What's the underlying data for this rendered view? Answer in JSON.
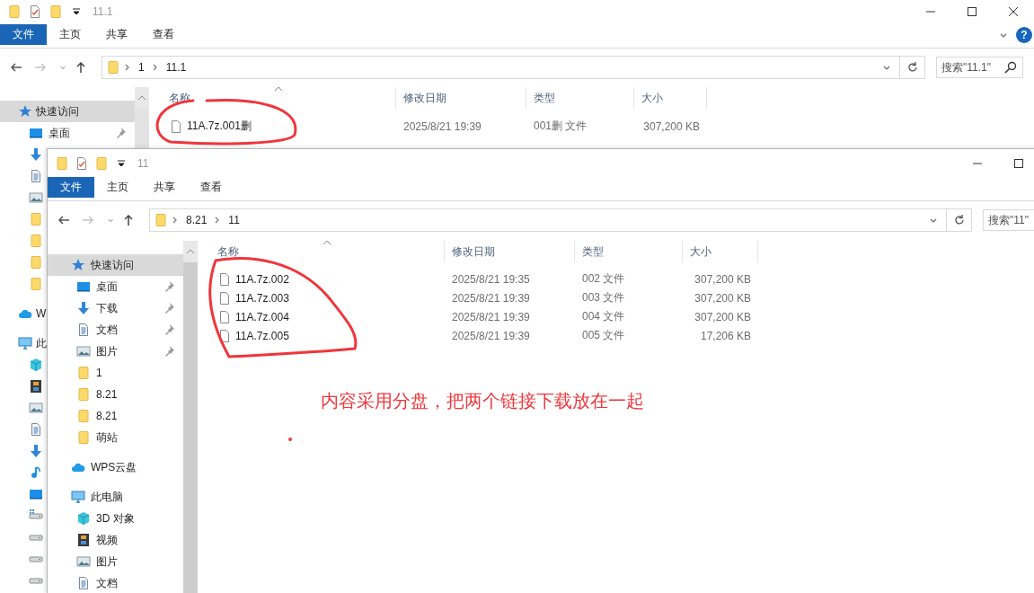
{
  "windows": [
    {
      "title": "11.1",
      "close_visible": true,
      "ribbon_tabs": [
        {
          "label": "文件",
          "selected": true
        },
        {
          "label": "主页",
          "selected": false
        },
        {
          "label": "共享",
          "selected": false
        },
        {
          "label": "查看",
          "selected": false
        }
      ],
      "ribbon_toggle": true,
      "help_button": "?",
      "forward_disabled": true,
      "path": [
        "1",
        "11.1"
      ],
      "search": {
        "placeholder": "搜索\"11.1\"",
        "icon": true
      },
      "sidebar": [
        {
          "kind": "star",
          "label": "快速访问",
          "selected": true,
          "children": [
            {
              "kind": "desktop",
              "label": "桌面",
              "pinned": true,
              "selected": false
            },
            {
              "kind": "download",
              "selected": false
            },
            {
              "kind": "doc",
              "selected": false
            },
            {
              "kind": "picture",
              "selected": false
            },
            {
              "kind": "folder",
              "selected": false
            },
            {
              "kind": "folder",
              "selected": false
            },
            {
              "kind": "folder",
              "selected": false
            },
            {
              "kind": "folder",
              "selected": false
            }
          ]
        },
        {
          "kind": "cloud",
          "label": "W",
          "selected": false
        },
        {
          "kind": "pc",
          "label": "此",
          "selected": false,
          "children": [
            {
              "kind": "cube",
              "selected": false
            },
            {
              "kind": "film",
              "selected": false
            },
            {
              "kind": "picture",
              "selected": false
            },
            {
              "kind": "doc",
              "selected": false
            },
            {
              "kind": "download",
              "selected": false
            },
            {
              "kind": "music",
              "selected": false
            },
            {
              "kind": "desktop",
              "selected": false
            },
            {
              "kind": "drivewin",
              "selected": false
            },
            {
              "kind": "drive",
              "selected": false
            },
            {
              "kind": "drive",
              "selected": false
            },
            {
              "kind": "drive",
              "selected": false
            }
          ]
        }
      ],
      "columns": [
        {
          "label": "名称",
          "sorted": true
        },
        {
          "label": "修改日期",
          "sorted": false
        },
        {
          "label": "类型",
          "sorted": false
        },
        {
          "label": "大小",
          "sorted": false
        }
      ],
      "files": [
        {
          "name": "11A.7z.001删",
          "modified": "2025/8/21 19:39",
          "type": "001删 文件",
          "size": "307,200 KB"
        }
      ]
    },
    {
      "title": "11",
      "close_visible": false,
      "ribbon_tabs": [
        {
          "label": "文件",
          "selected": true
        },
        {
          "label": "主页",
          "selected": false
        },
        {
          "label": "共享",
          "selected": false
        },
        {
          "label": "查看",
          "selected": false
        }
      ],
      "forward_disabled": true,
      "path": [
        "8.21",
        "11"
      ],
      "search": {
        "placeholder": "搜索\"11\""
      },
      "sidebar": [
        {
          "kind": "star",
          "label": "快速访问",
          "selected": true,
          "children": [
            {
              "kind": "desktop",
              "label": "桌面",
              "pinned": true,
              "selected": false
            },
            {
              "kind": "download",
              "label": "下载",
              "pinned": true,
              "selected": false
            },
            {
              "kind": "doc",
              "label": "文档",
              "pinned": true,
              "selected": false
            },
            {
              "kind": "picture",
              "label": "图片",
              "pinned": true,
              "selected": false
            },
            {
              "kind": "folder",
              "label": "1",
              "pinned": false,
              "selected": false
            },
            {
              "kind": "folder",
              "label": "8.21",
              "pinned": false,
              "selected": false
            },
            {
              "kind": "folder",
              "label": "8.21",
              "pinned": false,
              "selected": false
            },
            {
              "kind": "folder",
              "label": "萌站",
              "pinned": false,
              "selected": false
            }
          ]
        },
        {
          "kind": "cloud",
          "label": "WPS云盘",
          "selected": false
        },
        {
          "kind": "pc",
          "label": "此电脑",
          "selected": false,
          "children": [
            {
              "kind": "cube",
              "label": "3D 对象",
              "selected": false
            },
            {
              "kind": "film",
              "label": "视频",
              "selected": false
            },
            {
              "kind": "picture",
              "label": "图片",
              "selected": false
            },
            {
              "kind": "doc",
              "label": "文档",
              "selected": false
            }
          ]
        }
      ],
      "columns": [
        {
          "label": "名称",
          "sorted": true
        },
        {
          "label": "修改日期",
          "sorted": false
        },
        {
          "label": "类型",
          "sorted": false
        },
        {
          "label": "大小",
          "sorted": false
        }
      ],
      "files": [
        {
          "name": "11A.7z.002",
          "modified": "2025/8/21 19:35",
          "type": "002 文件",
          "size": "307,200 KB"
        },
        {
          "name": "11A.7z.003",
          "modified": "2025/8/21 19:39",
          "type": "003 文件",
          "size": "307,200 KB"
        },
        {
          "name": "11A.7z.004",
          "modified": "2025/8/21 19:39",
          "type": "004 文件",
          "size": "307,200 KB"
        },
        {
          "name": "11A.7z.005",
          "modified": "2025/8/21 19:39",
          "type": "005 文件",
          "size": "17,206 KB"
        }
      ]
    }
  ],
  "note": "内容采用分盘，把两个链接下载放在一起"
}
